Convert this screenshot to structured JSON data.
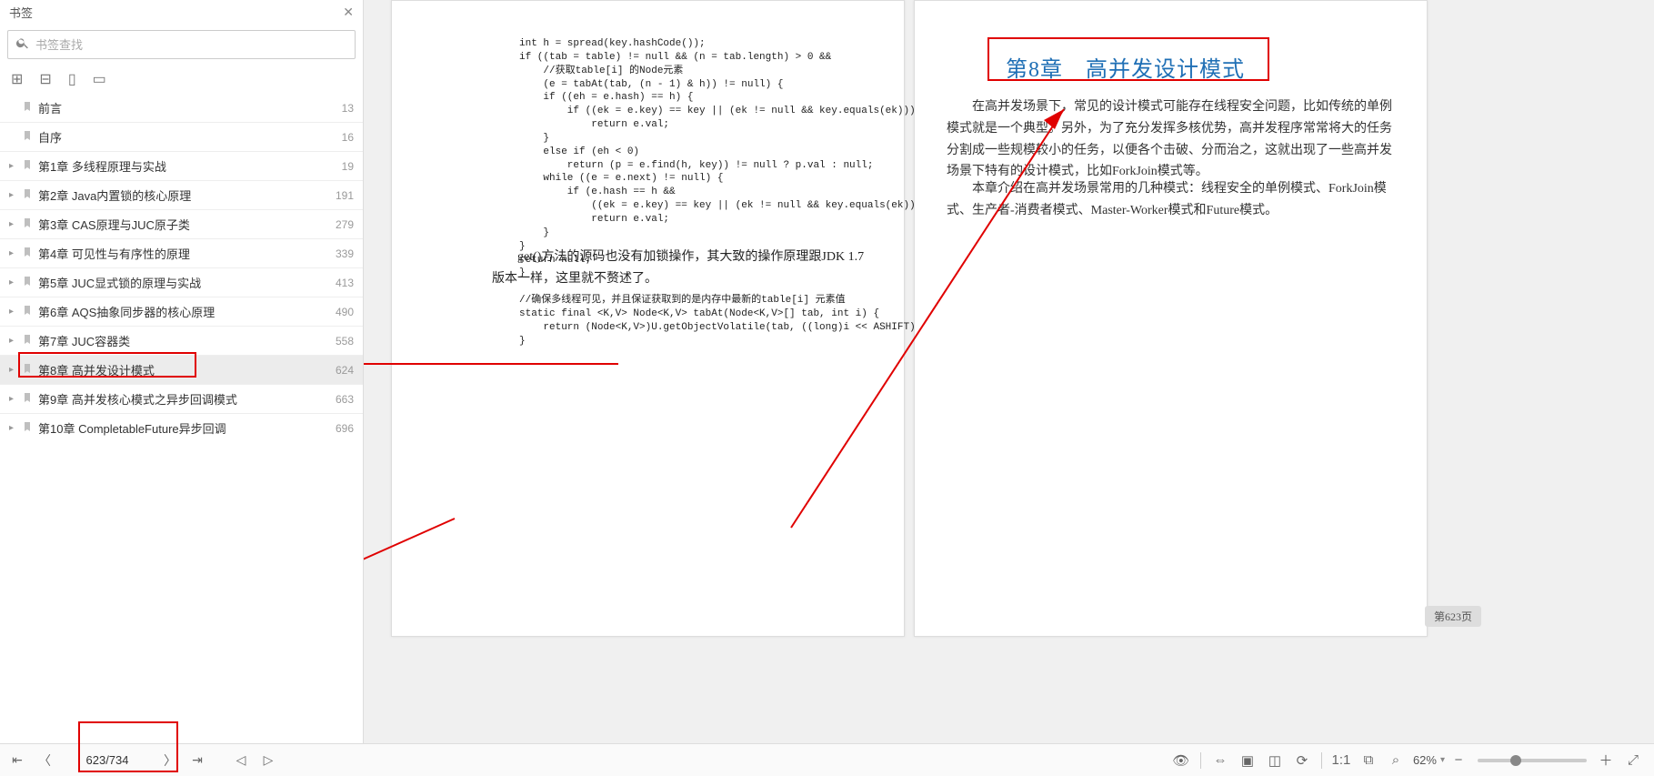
{
  "sidebar": {
    "title": "书签",
    "search_placeholder": "书签查找",
    "bookmarks": [
      {
        "title": "前言",
        "page": "13",
        "arrow": false
      },
      {
        "title": "自序",
        "page": "16",
        "arrow": false
      },
      {
        "title": "第1章 多线程原理与实战",
        "page": "19",
        "arrow": true
      },
      {
        "title": "第2章 Java内置锁的核心原理",
        "page": "191",
        "arrow": true
      },
      {
        "title": "第3章 CAS原理与JUC原子类",
        "page": "279",
        "arrow": true
      },
      {
        "title": "第4章 可见性与有序性的原理",
        "page": "339",
        "arrow": true
      },
      {
        "title": "第5章 JUC显式锁的原理与实战",
        "page": "413",
        "arrow": true
      },
      {
        "title": "第6章 AQS抽象同步器的核心原理",
        "page": "490",
        "arrow": true
      },
      {
        "title": "第7章 JUC容器类",
        "page": "558",
        "arrow": true
      },
      {
        "title": "第8章 高并发设计模式",
        "page": "624",
        "arrow": true,
        "active": true
      },
      {
        "title": "第9章 高并发核心模式之异步回调模式",
        "page": "663",
        "arrow": true
      },
      {
        "title": "第10章 CompletableFuture异步回调",
        "page": "696",
        "arrow": true
      }
    ]
  },
  "pageLeft": {
    "code": "int h = spread(key.hashCode());\nif ((tab = table) != null && (n = tab.length) > 0 &&\n    //获取table[i] 的Node元素\n    (e = tabAt(tab, (n - 1) & h)) != null) {\n    if ((eh = e.hash) == h) {\n        if ((ek = e.key) == key || (ek != null && key.equals(ek)))\n            return e.val;\n    }\n    else if (eh < 0)\n        return (p = e.find(h, key)) != null ? p.val : null;\n    while ((e = e.next) != null) {\n        if (e.hash == h &&\n            ((ek = e.key) == key || (ek != null && key.equals(ek))))\n            return e.val;\n    }\n}\nreturn null;\n}\n\n//确保多线程可见，并且保证获取到的是内存中最新的table[i] 元素值\nstatic final <K,V> Node<K,V> tabAt(Node<K,V>[] tab, int i) {\n    return (Node<K,V>)U.getObjectVolatile(tab, ((long)i << ASHIFT) + ABASE)\n}",
    "para": "get()方法的源码也没有加锁操作，其大致的操作原理跟JDK 1.7版本一样，这里就不赘述了。"
  },
  "pageRight": {
    "chapter_title": "第8章　高并发设计模式",
    "para1": "在高并发场景下，常见的设计模式可能存在线程安全问题，比如传统的单例模式就是一个典型。另外，为了充分发挥多核优势，高并发程序常常将大的任务分割成一些规模较小的任务，以便各个击破、分而治之，这就出现了一些高并发场景下特有的设计模式，比如ForkJoin模式等。",
    "para2": "本章介绍在高并发场景常用的几种模式：线程安全的单例模式、ForkJoin模式、生产者-消费者模式、Master-Worker模式和Future模式。",
    "page_badge": "第623页"
  },
  "footer": {
    "page_indicator": "623/734",
    "zoom": "62%"
  }
}
